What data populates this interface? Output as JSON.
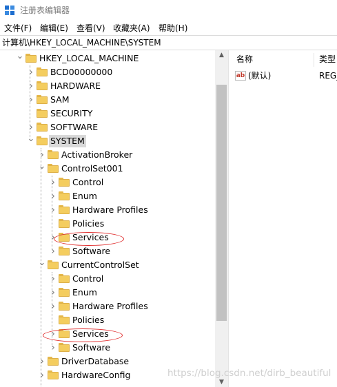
{
  "window": {
    "title": "注册表编辑器",
    "icon": "registry-editor-icon"
  },
  "menu": [
    "文件(F)",
    "编辑(E)",
    "查看(V)",
    "收藏夹(A)",
    "帮助(H)"
  ],
  "address": "计算机\\HKEY_LOCAL_MACHINE\\SYSTEM",
  "tree": [
    {
      "label": "HKEY_LOCAL_MACHINE",
      "expander": "expanded"
    },
    {
      "label": "BCD00000000",
      "expander": "collapsed"
    },
    {
      "label": "HARDWARE",
      "expander": "collapsed"
    },
    {
      "label": "SAM",
      "expander": "collapsed"
    },
    {
      "label": "SECURITY",
      "expander": "none"
    },
    {
      "label": "SOFTWARE",
      "expander": "collapsed"
    },
    {
      "label": "SYSTEM",
      "expander": "expanded",
      "selected": true
    },
    {
      "label": "ActivationBroker",
      "expander": "collapsed"
    },
    {
      "label": "ControlSet001",
      "expander": "expanded"
    },
    {
      "label": "Control",
      "expander": "collapsed"
    },
    {
      "label": "Enum",
      "expander": "collapsed"
    },
    {
      "label": "Hardware Profiles",
      "expander": "collapsed"
    },
    {
      "label": "Policies",
      "expander": "none"
    },
    {
      "label": "Services",
      "expander": "collapsed",
      "highlighted": true
    },
    {
      "label": "Software",
      "expander": "collapsed"
    },
    {
      "label": "CurrentControlSet",
      "expander": "expanded"
    },
    {
      "label": "Control",
      "expander": "collapsed"
    },
    {
      "label": "Enum",
      "expander": "collapsed"
    },
    {
      "label": "Hardware Profiles",
      "expander": "collapsed"
    },
    {
      "label": "Policies",
      "expander": "none"
    },
    {
      "label": "Services",
      "expander": "collapsed",
      "highlighted": true
    },
    {
      "label": "Software",
      "expander": "collapsed"
    },
    {
      "label": "DriverDatabase",
      "expander": "collapsed"
    },
    {
      "label": "HardwareConfig",
      "expander": "collapsed"
    }
  ],
  "values_pane": {
    "columns": [
      "名称",
      "类型"
    ],
    "rows": [
      {
        "name": "(默认)",
        "type": "REG_",
        "icon": "ab-string-icon",
        "icon_text": "ab"
      }
    ]
  },
  "scrollbar": {
    "up_arrow": "▲",
    "down_arrow": "▼"
  },
  "watermark": "https://blog.csdn.net/dirb_beautiful",
  "colors": {
    "folder": "#f4cd5f",
    "selected_bg": "#d9d9d9",
    "annotation": "#e03030",
    "title_gray": "#7a7a7a"
  }
}
